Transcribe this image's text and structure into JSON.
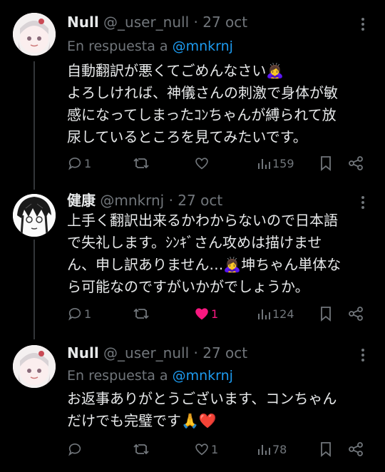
{
  "tweets": [
    {
      "name": "Null",
      "handle": "@_user_null",
      "sep": "·",
      "date": "27 oct",
      "reply_prefix": "En respuesta a",
      "reply_mention": "@mnkrnj",
      "lines": [
        "自動翻訳が悪くてごめんなさい🙇‍♀️",
        "よろしければ、神儀さんの刺激で身体が敏",
        "感になってしまったｺﾝちゃんが縛られて放",
        "尿しているところを見てみたいです。"
      ],
      "replies": "1",
      "reposts": "",
      "likes": "",
      "views": "159",
      "liked": false
    },
    {
      "name": "健康",
      "handle": "@mnkrnj",
      "sep": "·",
      "date": "27 oct",
      "lines": [
        "上手く翻訳出来るかわからないので日本語",
        "で失礼します。ｼﾝｷﾞさん攻めは描けませ",
        "ん、申し訳ありません…🙇‍♀️坤ちゃん単体な",
        "ら可能なのですがいかがでしょうか。"
      ],
      "replies": "1",
      "reposts": "",
      "likes": "1",
      "views": "124",
      "liked": true
    },
    {
      "name": "Null",
      "handle": "@_user_null",
      "sep": "·",
      "date": "27 oct",
      "reply_prefix": "En respuesta a",
      "reply_mention": "@mnkrnj",
      "lines": [
        "お返事ありがとうございます、コンちゃん",
        "だけでも完璧です🙏❤️"
      ],
      "replies": "",
      "reposts": "",
      "likes": "1",
      "views": "78",
      "liked": false
    }
  ],
  "icons": {
    "more": "more-dots-icon",
    "reply": "reply-icon",
    "repost": "repost-icon",
    "like": "heart-icon",
    "views": "views-icon",
    "bookmark": "bookmark-icon",
    "share": "share-icon"
  },
  "colors": {
    "background": "#000000",
    "text": "#e7e9ea",
    "secondary": "#71767b",
    "mention": "#1d9bf0",
    "like": "#f91880"
  }
}
